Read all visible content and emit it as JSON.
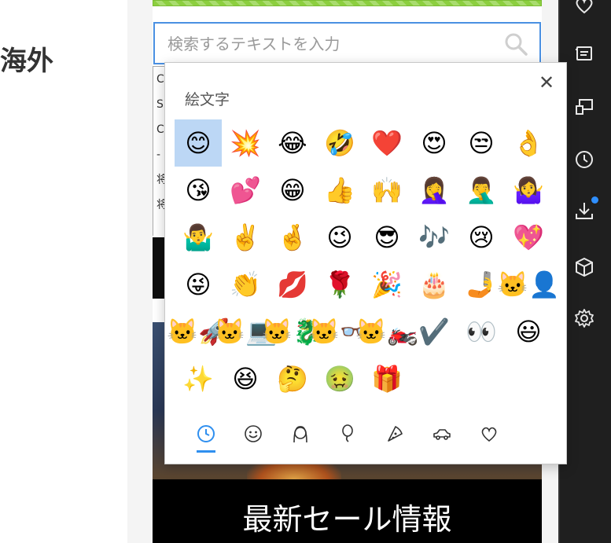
{
  "page": {
    "heading_fragment": "海外",
    "search": {
      "placeholder": "検索するテキストを入力"
    },
    "fragment_text": [
      "C",
      "S",
      "C",
      "-",
      "将",
      "将"
    ],
    "banner_title": "最新セール情報"
  },
  "emoji_picker": {
    "title": "絵文字",
    "close_glyph": "✕",
    "selected_index": 0,
    "emojis": [
      "😊",
      "💥",
      "😂",
      "🤣",
      "❤️",
      "😍",
      "😒",
      "👌",
      "😘",
      "💕",
      "😁",
      "👍",
      "🙌",
      "🤦‍♀️",
      "🤦‍♂️",
      "🤷‍♀️",
      "🤷‍♂️",
      "✌️",
      "🤞",
      "😉",
      "😎",
      "🎶",
      "😢",
      "💖",
      "😜",
      "👏",
      "💋",
      "🌹",
      "🎉",
      "🎂",
      "🤳",
      "🐱‍👤",
      "🐱‍🚀",
      "🐱‍💻",
      "🐱‍🐉",
      "🐱‍👓",
      "🐱‍🏍",
      "✔️",
      "👀",
      "😃",
      "✨",
      "😆",
      "🤔",
      "🤢",
      "🎁"
    ],
    "tabs": [
      {
        "id": "recent",
        "icon": "clock-icon",
        "active": true
      },
      {
        "id": "smileys",
        "icon": "smiley-icon",
        "active": false
      },
      {
        "id": "people",
        "icon": "person-icon",
        "active": false
      },
      {
        "id": "celebration",
        "icon": "balloon-icon",
        "active": false
      },
      {
        "id": "food",
        "icon": "pizza-icon",
        "active": false
      },
      {
        "id": "travel",
        "icon": "car-icon",
        "active": false
      },
      {
        "id": "symbols",
        "icon": "heart-icon",
        "active": false
      }
    ]
  },
  "sidebar": {
    "icons": [
      "favorites-heart-icon",
      "reading-list-icon",
      "cast-icon",
      "history-clock-icon",
      "downloads-icon",
      "package-icon",
      "settings-gear-icon"
    ],
    "download_badge_color": "#2f8fff"
  },
  "colors": {
    "accent": "#2f8fef",
    "selected_bg": "#bcd7f5",
    "sidebar_bg": "#1f1f1f"
  }
}
